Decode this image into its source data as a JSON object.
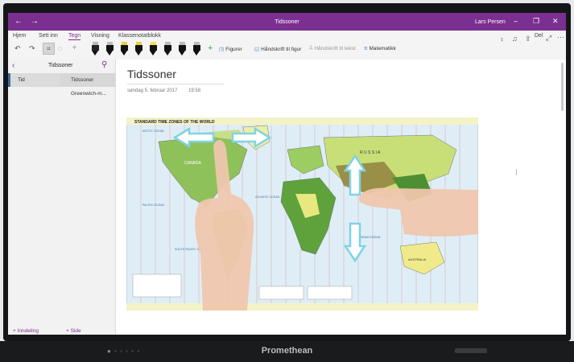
{
  "window": {
    "title": "Tidssoner",
    "user": "Lars Persen",
    "back": "←",
    "forward": "→",
    "minimize": "–",
    "maximize": "❐",
    "close": "✕"
  },
  "ribbon": {
    "tabs": [
      "Hjem",
      "Sett inn",
      "Tegn",
      "Visning",
      "Klassenotatblokk"
    ],
    "active_tab": "Tegn",
    "share_label": "Del",
    "buttons": {
      "figurer": "Figurer",
      "handskrift_figur": "Håndskrift til figur",
      "handskrift_tekst": "Håndskrift til tekst",
      "matematikk": "Matematikk"
    }
  },
  "sidebar": {
    "header_title": "Tidssoner",
    "section": "Tid",
    "pages": [
      "Tidssoner",
      "Greenwich-m..."
    ],
    "add_section": "+ Inndeling",
    "add_page": "+ Side"
  },
  "page": {
    "title": "Tidssoner",
    "date": "søndag 5. februar 2017",
    "time": "19:58"
  },
  "map": {
    "title": "STANDARD TIME ZONES OF THE WORLD",
    "labels": [
      "CANADA",
      "R U S S I A",
      "AUSTRALIA",
      "ARCTIC OCEAN",
      "PACIFIC OCEAN",
      "ATLANTIC OCEAN",
      "INDIAN OCEAN",
      "SOUTH PACIFIC OCEAN"
    ]
  },
  "device": {
    "brand": "Promethean",
    "buttons": "● ◦ ◦ ◦ ◦ ◦"
  },
  "colors": {
    "accent": "#7b2f91",
    "arrow": "#7fd3e6",
    "ocean": "#dfeef6"
  }
}
